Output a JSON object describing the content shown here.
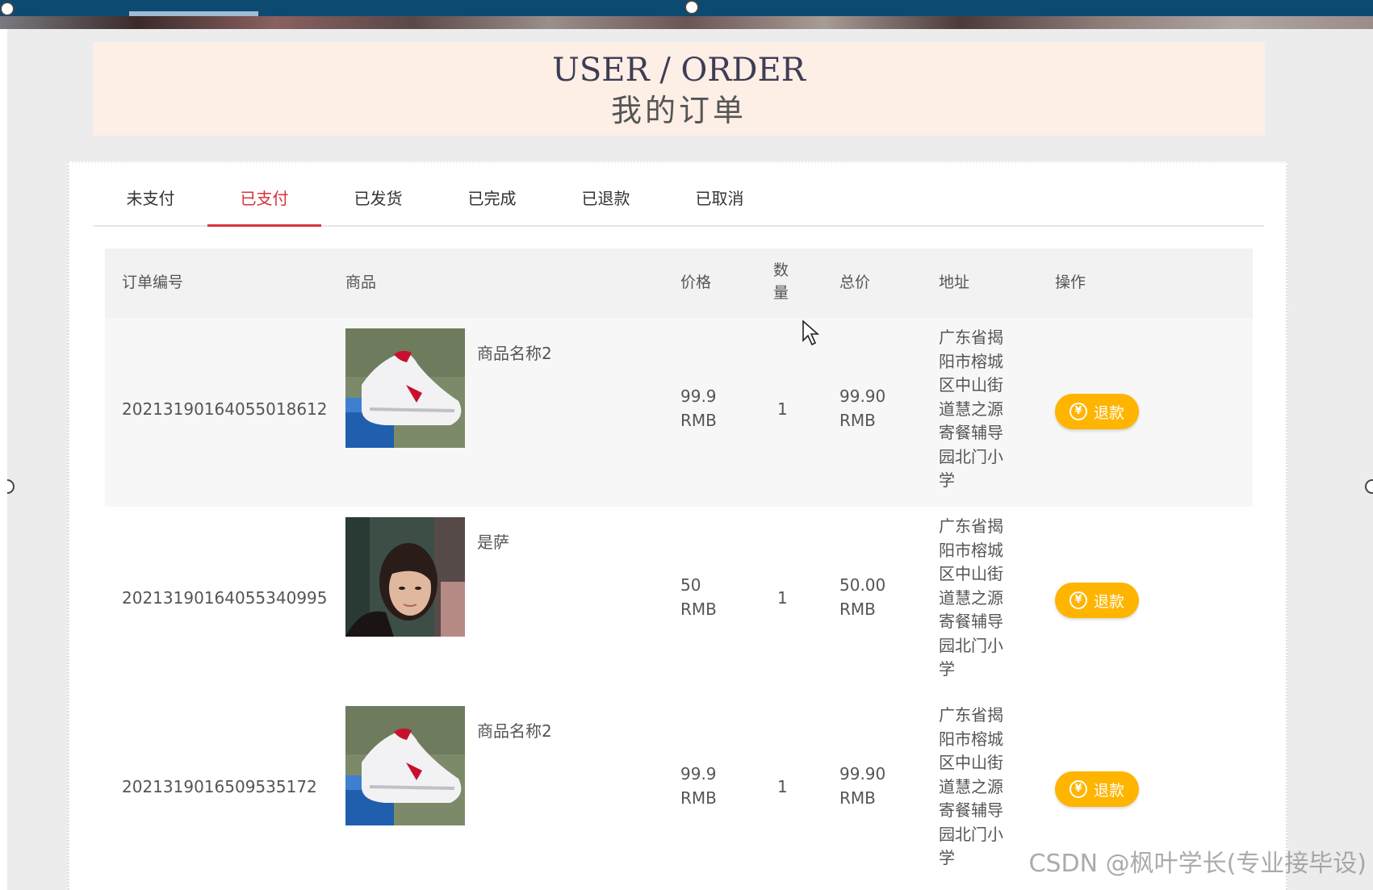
{
  "header": {
    "title_en": "USER / ORDER",
    "title_zh": "我的订单"
  },
  "tabs": [
    {
      "label": "未支付",
      "active": false
    },
    {
      "label": "已支付",
      "active": true
    },
    {
      "label": "已发货",
      "active": false
    },
    {
      "label": "已完成",
      "active": false
    },
    {
      "label": "已退款",
      "active": false
    },
    {
      "label": "已取消",
      "active": false
    }
  ],
  "table": {
    "columns": [
      "订单编号",
      "商品",
      "价格",
      "数量",
      "总价",
      "地址",
      "操作"
    ],
    "rows": [
      {
        "order_no": "2021319016405501861​2",
        "product": "商品名称2",
        "image": "sneaker",
        "price": "99.9",
        "price_unit": "RMB",
        "qty": "1",
        "total": "99.90",
        "total_unit": "RMB",
        "address": "广东省揭阳市榕城区中山街道慧之源寄餐辅导园北门小学",
        "action": "退款"
      },
      {
        "order_no": "20213190164055340995",
        "product": "是萨",
        "image": "portrait",
        "price": "50",
        "price_unit": "RMB",
        "qty": "1",
        "total": "50.00",
        "total_unit": "RMB",
        "address": "广东省揭阳市榕城区中山街道慧之源寄餐辅导园北门小学",
        "action": "退款"
      },
      {
        "order_no": "2021319016509535172",
        "product": "商品名称2",
        "image": "sneaker",
        "price": "99.9",
        "price_unit": "RMB",
        "qty": "1",
        "total": "99.90",
        "total_unit": "RMB",
        "address": "广东省揭阳市榕城区中山街道慧之源寄餐辅导园北门小学",
        "action": "退款"
      }
    ]
  },
  "icons": {
    "refund": "yen-icon",
    "cursor": "mouse-pointer-icon"
  },
  "colors": {
    "accent": "#d9333a",
    "refund_button": "#ffb400",
    "header_bg": "#fdeee6"
  },
  "watermark": "CSDN @枫叶学长(专业接毕设)"
}
